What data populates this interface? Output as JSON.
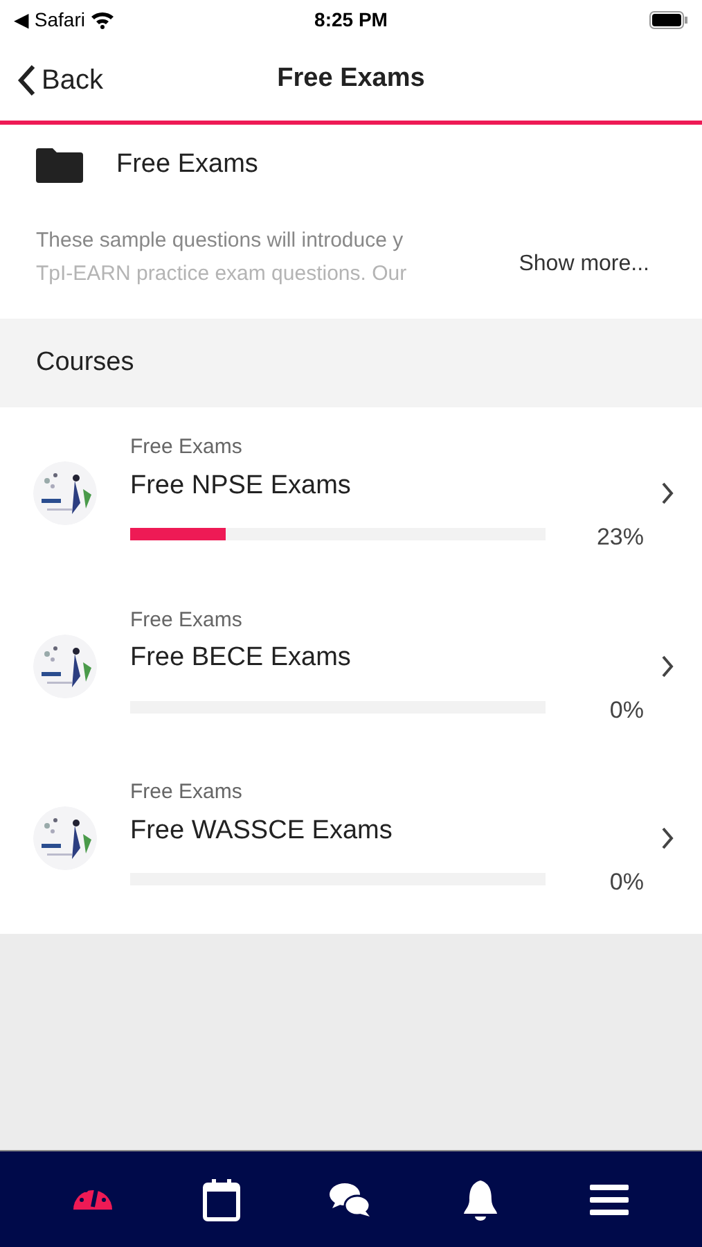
{
  "status_bar": {
    "back_app": "◀ Safari",
    "time": "8:25 PM"
  },
  "nav": {
    "back": "Back",
    "title": "Free Exams"
  },
  "folder": {
    "title": "Free Exams",
    "description": [
      "These sample questions will introduce y",
      "TpI-EARN practice exam questions. Our"
    ],
    "show_more": "Show more..."
  },
  "section": {
    "title": "Courses"
  },
  "courses": [
    {
      "category": "Free Exams",
      "title": "Free NPSE Exams",
      "level": 0.23,
      "percent": "23%"
    },
    {
      "category": "Free Exams",
      "title": "Free BECE Exams",
      "level": 0,
      "percent": "0%"
    },
    {
      "category": "Free Exams",
      "title": "Free WASSCE Exams",
      "level": 0,
      "percent": "0%"
    }
  ],
  "tabs": [
    {
      "kind": "dashboard",
      "selected": true
    },
    {
      "kind": "calendar",
      "selected": false
    },
    {
      "kind": "chat",
      "selected": false
    },
    {
      "kind": "bell",
      "selected": false
    },
    {
      "kind": "menu",
      "selected": false
    }
  ]
}
